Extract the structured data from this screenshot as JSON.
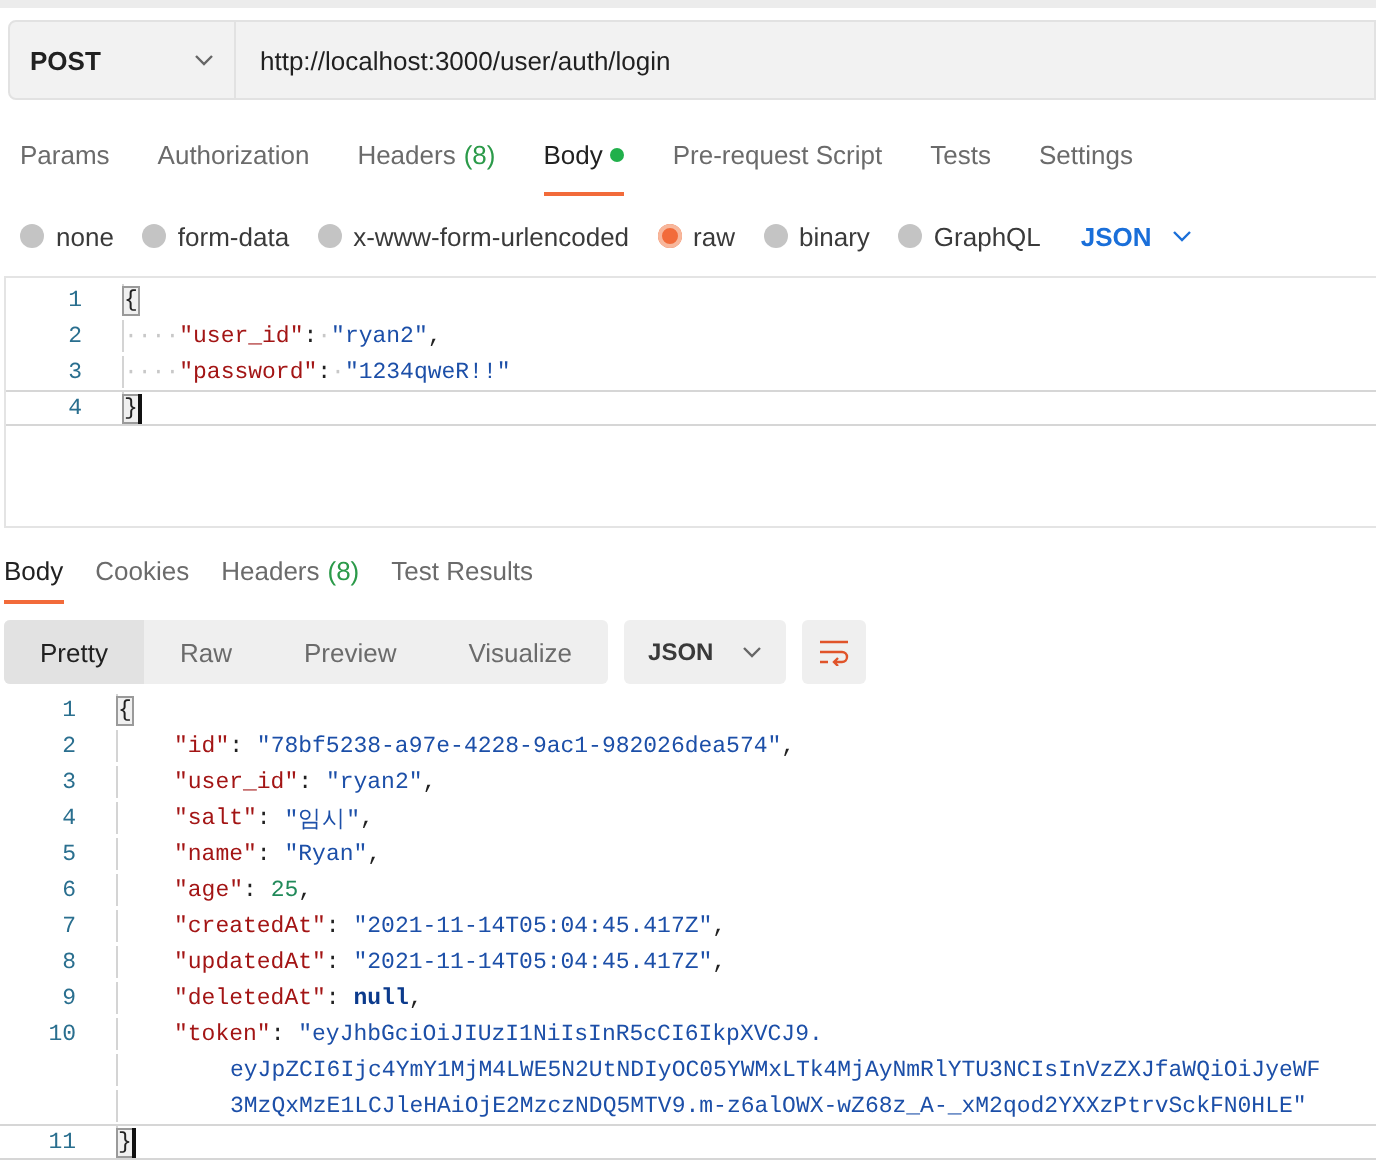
{
  "request": {
    "method": "POST",
    "url": "http://localhost:3000/user/auth/login"
  },
  "request_tabs": [
    {
      "label": "Params",
      "selected": false
    },
    {
      "label": "Authorization",
      "selected": false
    },
    {
      "label": "Headers",
      "count": "(8)",
      "selected": false
    },
    {
      "label": "Body",
      "has_content": true,
      "selected": true
    },
    {
      "label": "Pre-request Script",
      "selected": false
    },
    {
      "label": "Tests",
      "selected": false
    },
    {
      "label": "Settings",
      "selected": false
    }
  ],
  "body_types": [
    {
      "label": "none",
      "selected": false
    },
    {
      "label": "form-data",
      "selected": false
    },
    {
      "label": "x-www-form-urlencoded",
      "selected": false
    },
    {
      "label": "raw",
      "selected": true
    },
    {
      "label": "binary",
      "selected": false
    },
    {
      "label": "GraphQL",
      "selected": false
    }
  ],
  "raw_format": "JSON",
  "request_editor": [
    {
      "number": "1",
      "kind": "top",
      "active": false,
      "tokens": [
        {
          "kind": "brace",
          "text": "{"
        }
      ]
    },
    {
      "number": "2",
      "kind": "top",
      "active": false,
      "tokens": [
        {
          "kind": "ws",
          "text": "····"
        },
        {
          "kind": "key",
          "text": "\"user_id\""
        },
        {
          "kind": "punct",
          "text": ":"
        },
        {
          "kind": "ws",
          "text": "·"
        },
        {
          "kind": "string",
          "text": "\"ryan2\""
        },
        {
          "kind": "punct",
          "text": ","
        }
      ]
    },
    {
      "number": "3",
      "kind": "top",
      "active": false,
      "tokens": [
        {
          "kind": "ws",
          "text": "····"
        },
        {
          "kind": "key",
          "text": "\"password\""
        },
        {
          "kind": "punct",
          "text": ":"
        },
        {
          "kind": "ws",
          "text": "·"
        },
        {
          "kind": "string",
          "text": "\"1234qweR!!\""
        }
      ]
    },
    {
      "number": "4",
      "kind": "top",
      "active": true,
      "tokens": [
        {
          "kind": "brace",
          "text": "}"
        }
      ]
    }
  ],
  "response_tabs": [
    {
      "label": "Body",
      "selected": true
    },
    {
      "label": "Cookies",
      "selected": false
    },
    {
      "label": "Headers",
      "count": "(8)",
      "selected": false
    },
    {
      "label": "Test Results",
      "selected": false
    }
  ],
  "view_modes": [
    {
      "label": "Pretty",
      "selected": true
    },
    {
      "label": "Raw",
      "selected": false
    },
    {
      "label": "Preview",
      "selected": false
    },
    {
      "label": "Visualize",
      "selected": false
    }
  ],
  "response_format": "JSON",
  "response_body": [
    {
      "number": "1",
      "kind": "top",
      "active": false,
      "tokens": [
        {
          "kind": "brace",
          "text": "{"
        }
      ]
    },
    {
      "number": "2",
      "kind": "member",
      "active": false,
      "tokens": [
        {
          "kind": "key",
          "text": "\"id\""
        },
        {
          "kind": "punct",
          "text": ": "
        },
        {
          "kind": "string",
          "text": "\"78bf5238-a97e-4228-9ac1-982026dea574\""
        },
        {
          "kind": "punct",
          "text": ","
        }
      ]
    },
    {
      "number": "3",
      "kind": "member",
      "active": false,
      "tokens": [
        {
          "kind": "key",
          "text": "\"user_id\""
        },
        {
          "kind": "punct",
          "text": ": "
        },
        {
          "kind": "string",
          "text": "\"ryan2\""
        },
        {
          "kind": "punct",
          "text": ","
        }
      ]
    },
    {
      "number": "4",
      "kind": "member",
      "active": false,
      "tokens": [
        {
          "kind": "key",
          "text": "\"salt\""
        },
        {
          "kind": "punct",
          "text": ": "
        },
        {
          "kind": "string",
          "text": "\"임시\""
        },
        {
          "kind": "punct",
          "text": ","
        }
      ]
    },
    {
      "number": "5",
      "kind": "member",
      "active": false,
      "tokens": [
        {
          "kind": "key",
          "text": "\"name\""
        },
        {
          "kind": "punct",
          "text": ": "
        },
        {
          "kind": "string",
          "text": "\"Ryan\""
        },
        {
          "kind": "punct",
          "text": ","
        }
      ]
    },
    {
      "number": "6",
      "kind": "member",
      "active": false,
      "tokens": [
        {
          "kind": "key",
          "text": "\"age\""
        },
        {
          "kind": "punct",
          "text": ": "
        },
        {
          "kind": "number",
          "text": "25"
        },
        {
          "kind": "punct",
          "text": ","
        }
      ]
    },
    {
      "number": "7",
      "kind": "member",
      "active": false,
      "tokens": [
        {
          "kind": "key",
          "text": "\"createdAt\""
        },
        {
          "kind": "punct",
          "text": ": "
        },
        {
          "kind": "string",
          "text": "\"2021-11-14T05:04:45.417Z\""
        },
        {
          "kind": "punct",
          "text": ","
        }
      ]
    },
    {
      "number": "8",
      "kind": "member",
      "active": false,
      "tokens": [
        {
          "kind": "key",
          "text": "\"updatedAt\""
        },
        {
          "kind": "punct",
          "text": ": "
        },
        {
          "kind": "string",
          "text": "\"2021-11-14T05:04:45.417Z\""
        },
        {
          "kind": "punct",
          "text": ","
        }
      ]
    },
    {
      "number": "9",
      "kind": "member",
      "active": false,
      "tokens": [
        {
          "kind": "key",
          "text": "\"deletedAt\""
        },
        {
          "kind": "punct",
          "text": ": "
        },
        {
          "kind": "keyword",
          "text": "null"
        },
        {
          "kind": "punct",
          "text": ","
        }
      ]
    },
    {
      "number": "10",
      "kind": "member",
      "active": false,
      "tokens": [
        {
          "kind": "key",
          "text": "\"token\""
        },
        {
          "kind": "punct",
          "text": ": "
        },
        {
          "kind": "string",
          "text": "\"eyJhbGciOiJIUzI1NiIsInR5cCI6IkpXVCJ9."
        }
      ]
    },
    {
      "kind": "continuation",
      "active": false,
      "tokens": [
        {
          "kind": "string",
          "text": "eyJpZCI6Ijc4YmY1MjM4LWE5N2UtNDIyOC05YWMxLTk4MjAyNmRlYTU3NCIsInVzZXJfaWQiOiJyeWF"
        }
      ]
    },
    {
      "kind": "continuation",
      "active": false,
      "tokens": [
        {
          "kind": "string",
          "text": "3MzQxMzE1LCJleHAiOjE2MzczNDQ5MTV9.m-z6alOWX-wZ68z_A-_xM2qod2YXXzPtrvSckFN0HLE\""
        }
      ]
    },
    {
      "number": "11",
      "kind": "top",
      "active": true,
      "tokens": [
        {
          "kind": "brace",
          "text": "}"
        }
      ]
    }
  ]
}
